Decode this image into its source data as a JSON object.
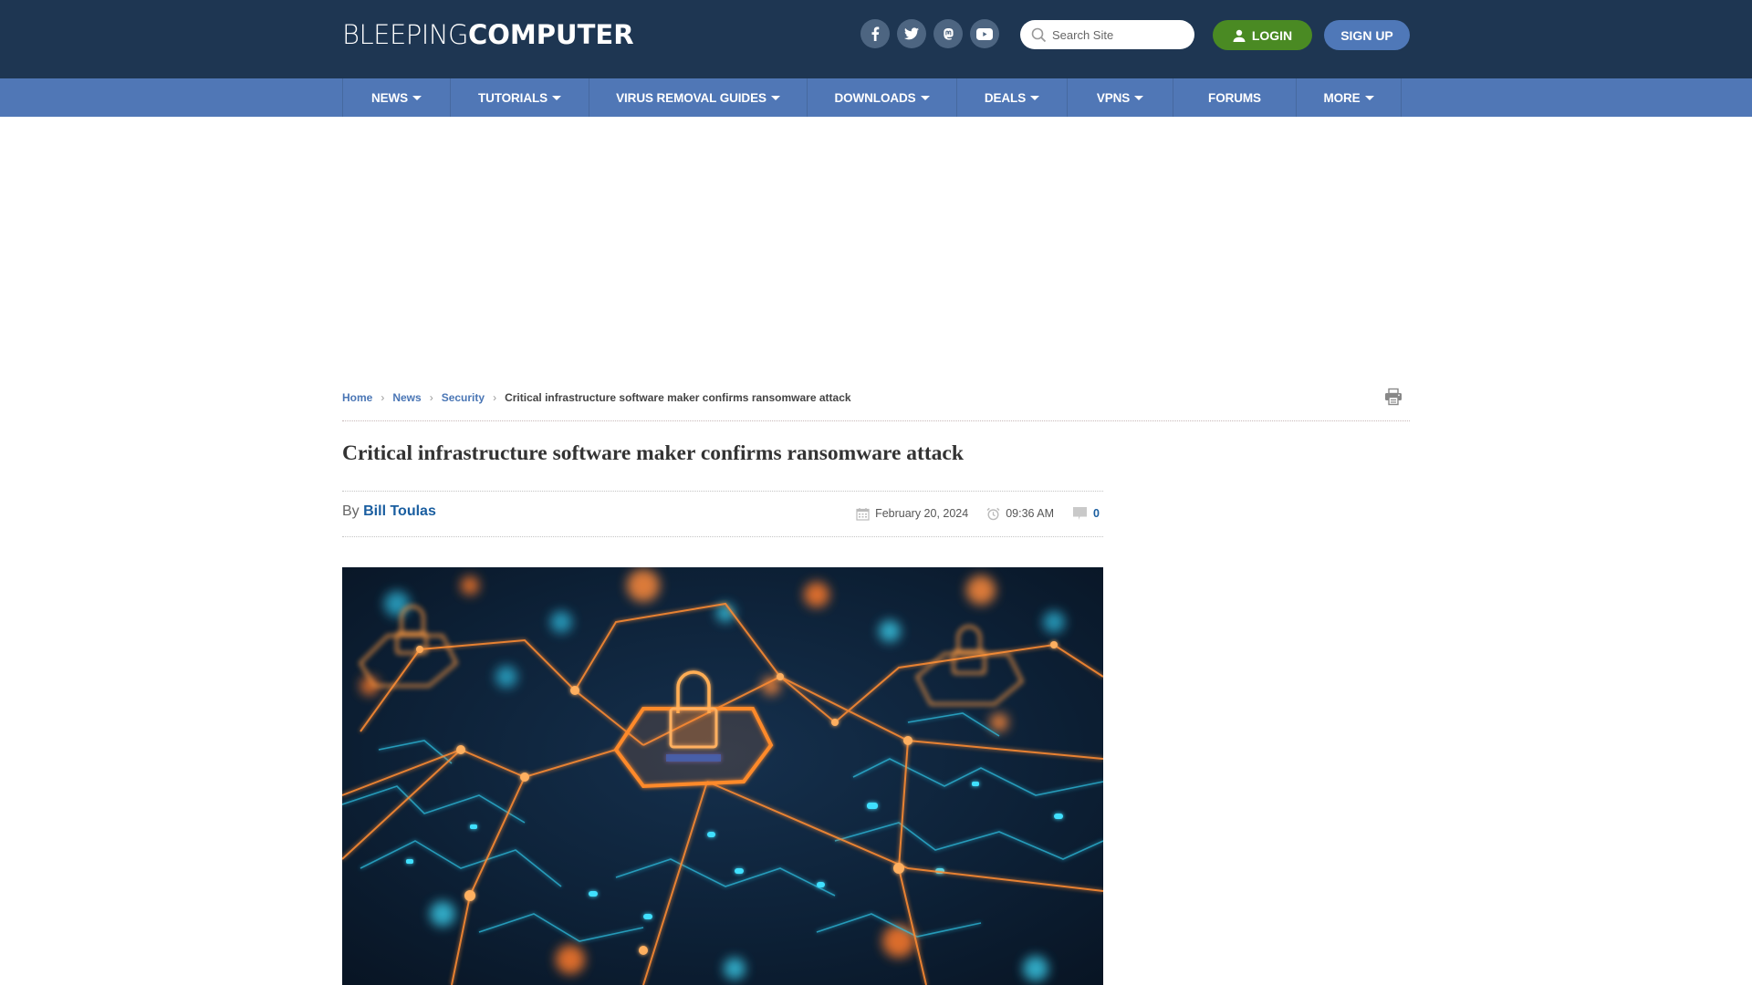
{
  "header": {
    "logo": {
      "light": "BLEEPING",
      "bold": "COMPUTER"
    },
    "social": [
      {
        "name": "facebook",
        "icon": "facebook-icon"
      },
      {
        "name": "twitter",
        "icon": "twitter-icon"
      },
      {
        "name": "mastodon",
        "icon": "mastodon-icon"
      },
      {
        "name": "youtube",
        "icon": "youtube-icon"
      }
    ],
    "search": {
      "placeholder": "Search Site",
      "value": ""
    },
    "login_label": "LOGIN",
    "signup_label": "SIGN UP"
  },
  "nav": {
    "items": [
      {
        "label": "NEWS",
        "dropdown": true
      },
      {
        "label": "TUTORIALS",
        "dropdown": true
      },
      {
        "label": "VIRUS REMOVAL GUIDES",
        "dropdown": true
      },
      {
        "label": "DOWNLOADS",
        "dropdown": true
      },
      {
        "label": "DEALS",
        "dropdown": true
      },
      {
        "label": "VPNS",
        "dropdown": true
      },
      {
        "label": "FORUMS",
        "dropdown": false
      },
      {
        "label": "MORE",
        "dropdown": true
      }
    ]
  },
  "breadcrumb": {
    "items": [
      "Home",
      "News",
      "Security"
    ],
    "current": "Critical infrastructure software maker confirms ransomware attack"
  },
  "article": {
    "title": "Critical infrastructure software maker confirms ransomware attack",
    "by_label": "By",
    "author": "Bill Toulas",
    "date": "February 20, 2024",
    "time": "09:36 AM",
    "comment_count": "0",
    "hero_alt": "Glowing orange padlocks on hexagonal nodes over a blue circuit board network"
  },
  "colors": {
    "header_bg": "#1e3652",
    "nav_bg": "#5077b6",
    "login_green": "#4a8a23",
    "signup_blue": "#4f78b8",
    "link_blue": "#1a5ea0",
    "breadcrumb_blue": "#4a76b5"
  }
}
